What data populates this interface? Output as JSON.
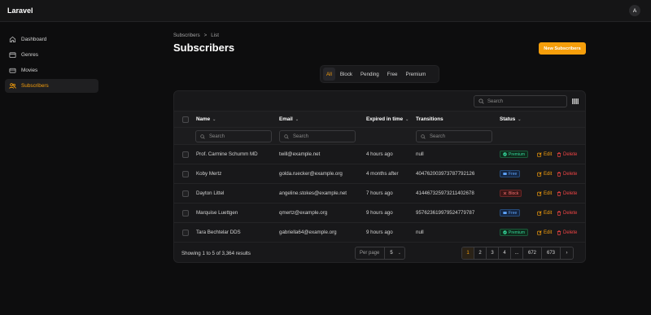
{
  "app": {
    "brand": "Laravel",
    "avatar_initial": "A"
  },
  "sidebar": {
    "items": [
      {
        "label": "Dashboard",
        "icon": "home-icon"
      },
      {
        "label": "Genres",
        "icon": "folder-icon"
      },
      {
        "label": "Movies",
        "icon": "film-icon"
      },
      {
        "label": "Subscribers",
        "icon": "users-icon",
        "active": true
      }
    ]
  },
  "breadcrumb": {
    "parent": "Subscribers",
    "separator": ">",
    "current": "List"
  },
  "page": {
    "title": "Subscribers",
    "new_button": "New Subscribers"
  },
  "tabs": [
    {
      "label": "All",
      "active": true
    },
    {
      "label": "Block"
    },
    {
      "label": "Pending"
    },
    {
      "label": "Free"
    },
    {
      "label": "Premium"
    }
  ],
  "table": {
    "search_placeholder": "Search",
    "columns": {
      "name": "Name",
      "email": "Email",
      "expired": "Expired in time",
      "transitions": "Transitions",
      "status": "Status"
    },
    "filter_placeholder": "Search",
    "rows": [
      {
        "name": "Prof. Carmine Schumm MD",
        "email": "twill@example.net",
        "expired": "4 hours ago",
        "transitions": "null",
        "status": "Premium",
        "status_type": "premium"
      },
      {
        "name": "Koby Mertz",
        "email": "golda.ruecker@example.org",
        "expired": "4 months after",
        "transitions": "404762003973787792126",
        "status": "Free",
        "status_type": "free"
      },
      {
        "name": "Dayton Littel",
        "email": "angeline.stokes@example.net",
        "expired": "7 hours ago",
        "transitions": "414467325973211402678",
        "status": "Block",
        "status_type": "block"
      },
      {
        "name": "Marquise Luettgen",
        "email": "qmertz@example.org",
        "expired": "9 hours ago",
        "transitions": "957623619979524779787",
        "status": "Free",
        "status_type": "free"
      },
      {
        "name": "Tara Bechtelar DDS",
        "email": "gabriella64@example.org",
        "expired": "9 hours ago",
        "transitions": "null",
        "status": "Premium",
        "status_type": "premium"
      }
    ],
    "edit_label": "Edit",
    "delete_label": "Delete"
  },
  "footer": {
    "showing": "Showing 1 to 5 of 3,364 results",
    "per_page_label": "Per page",
    "per_page_value": "5",
    "pages": [
      "1",
      "2",
      "3",
      "4",
      "...",
      "672",
      "673",
      "›"
    ],
    "active_page": "1"
  },
  "colors": {
    "accent": "#f59e0b",
    "danger": "#ef4444",
    "success": "#34d399",
    "info": "#60a5fa"
  }
}
